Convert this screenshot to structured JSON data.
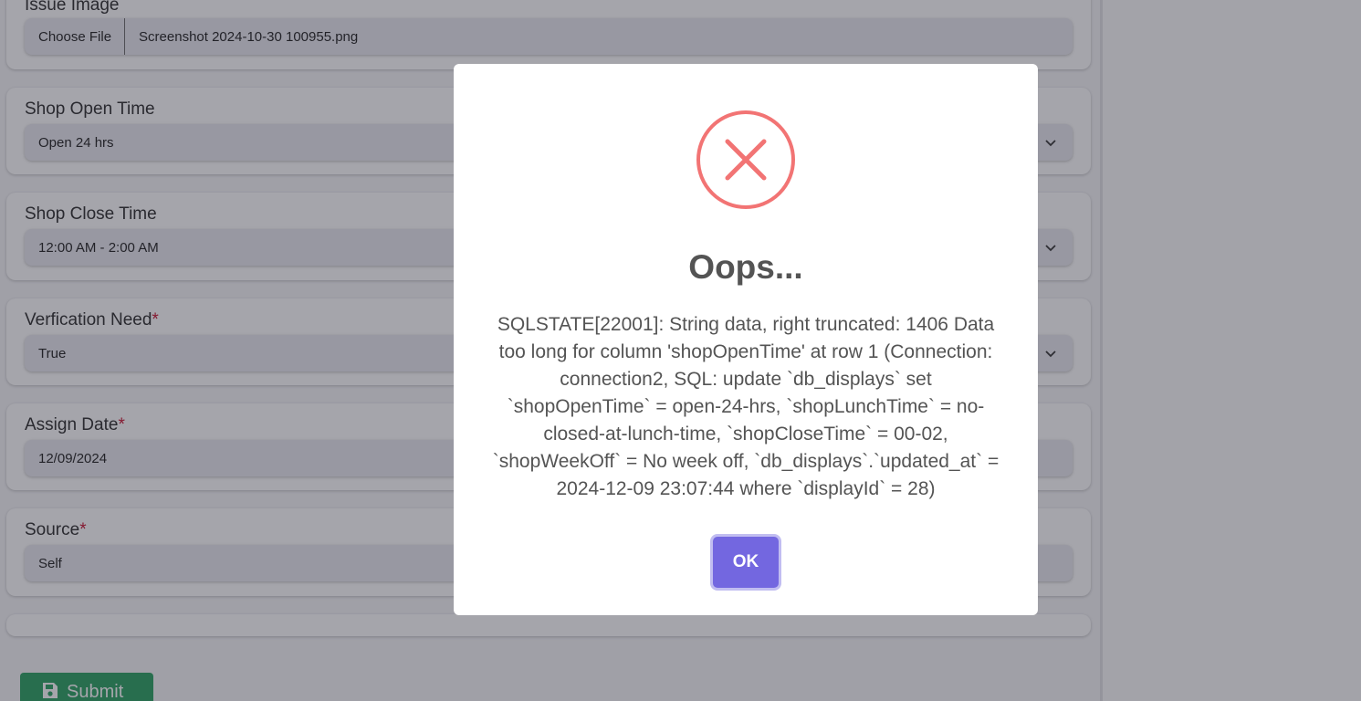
{
  "form": {
    "issue_image": {
      "label": "Issue Image",
      "choose_file_label": "Choose File",
      "file_name": "Screenshot 2024-10-30 100955.png"
    },
    "shop_open_time": {
      "label": "Shop Open Time",
      "value": "Open 24 hrs"
    },
    "shop_close_time": {
      "label": "Shop Close Time",
      "value": "12:00 AM - 2:00 AM"
    },
    "verification_need": {
      "label": "Verfication Need",
      "required_mark": "*",
      "value": "True"
    },
    "assign_date": {
      "label": "Assign Date",
      "required_mark": "*",
      "value": "12/09/2024"
    },
    "source": {
      "label": "Source",
      "required_mark": "*",
      "value": "Self"
    },
    "submit_label": "Submit",
    "submit_icon": "save-icon"
  },
  "dialog": {
    "icon": "error-x-icon",
    "title": "Oops...",
    "message": "SQLSTATE[22001]: String data, right truncated: 1406 Data too long for column 'shopOpenTime' at row 1 (Connection: connection2, SQL: update `db_displays` set `shopOpenTime` = open-24-hrs, `shopLunchTime` = no-closed-at-lunch-time, `shopCloseTime` = 00-02, `shopWeekOff` = No week off, `db_displays`.`updated_at` = 2024-12-09 23:07:44 where `displayId` = 28)",
    "ok_label": "OK"
  },
  "colors": {
    "error_icon": "#f27474",
    "ok_button": "#7367e0",
    "submit_button": "#28a060",
    "required_mark": "#c8102e"
  }
}
